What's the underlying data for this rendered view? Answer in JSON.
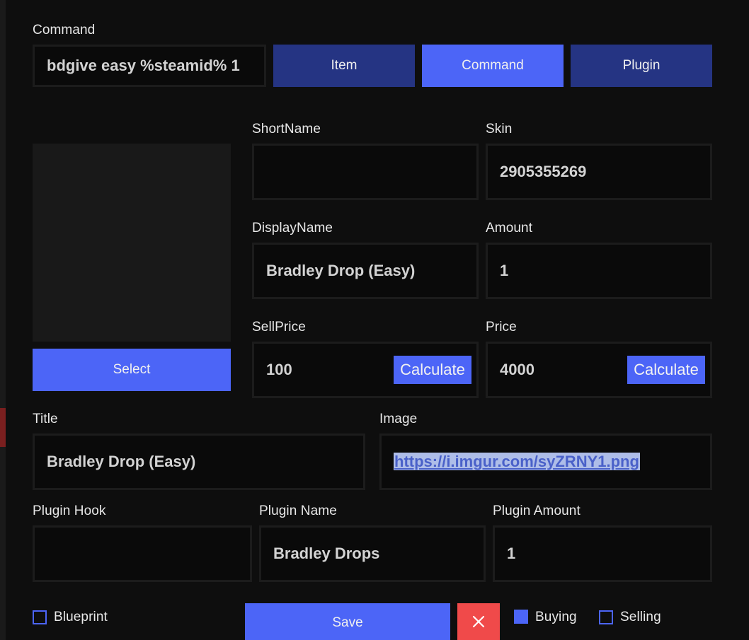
{
  "command": {
    "label": "Command",
    "value": "bdgive easy %steamid% 1",
    "tabs": [
      {
        "label": "Item",
        "active": false
      },
      {
        "label": "Command",
        "active": true
      },
      {
        "label": "Plugin",
        "active": false
      }
    ]
  },
  "preview": {
    "select_label": "Select"
  },
  "fields": {
    "shortname": {
      "label": "ShortName",
      "value": ""
    },
    "skin": {
      "label": "Skin",
      "value": "2905355269"
    },
    "displayname": {
      "label": "DisplayName",
      "value": "Bradley Drop (Easy)"
    },
    "amount": {
      "label": "Amount",
      "value": "1"
    },
    "sellprice": {
      "label": "SellPrice",
      "value": "100",
      "button": "Calculate"
    },
    "price": {
      "label": "Price",
      "value": "4000",
      "button": "Calculate"
    },
    "title": {
      "label": "Title",
      "value": "Bradley Drop (Easy)"
    },
    "image": {
      "label": "Image",
      "value": "https://i.imgur.com/syZRNY1.png"
    },
    "plugin_hook": {
      "label": "Plugin Hook",
      "value": ""
    },
    "plugin_name": {
      "label": "Plugin Name",
      "value": "Bradley Drops"
    },
    "plugin_amount": {
      "label": "Plugin Amount",
      "value": "1"
    }
  },
  "footer": {
    "blueprint": {
      "label": "Blueprint",
      "checked": false
    },
    "save_label": "Save",
    "close_icon": "close-icon",
    "buying": {
      "label": "Buying",
      "checked": true
    },
    "selling": {
      "label": "Selling",
      "checked": false
    }
  },
  "colors": {
    "accent": "#4c65f7",
    "tab_inactive": "#253483",
    "danger": "#f04a4a",
    "panel_bg": "#0e0e0e",
    "field_bg": "#0a0a0a"
  }
}
